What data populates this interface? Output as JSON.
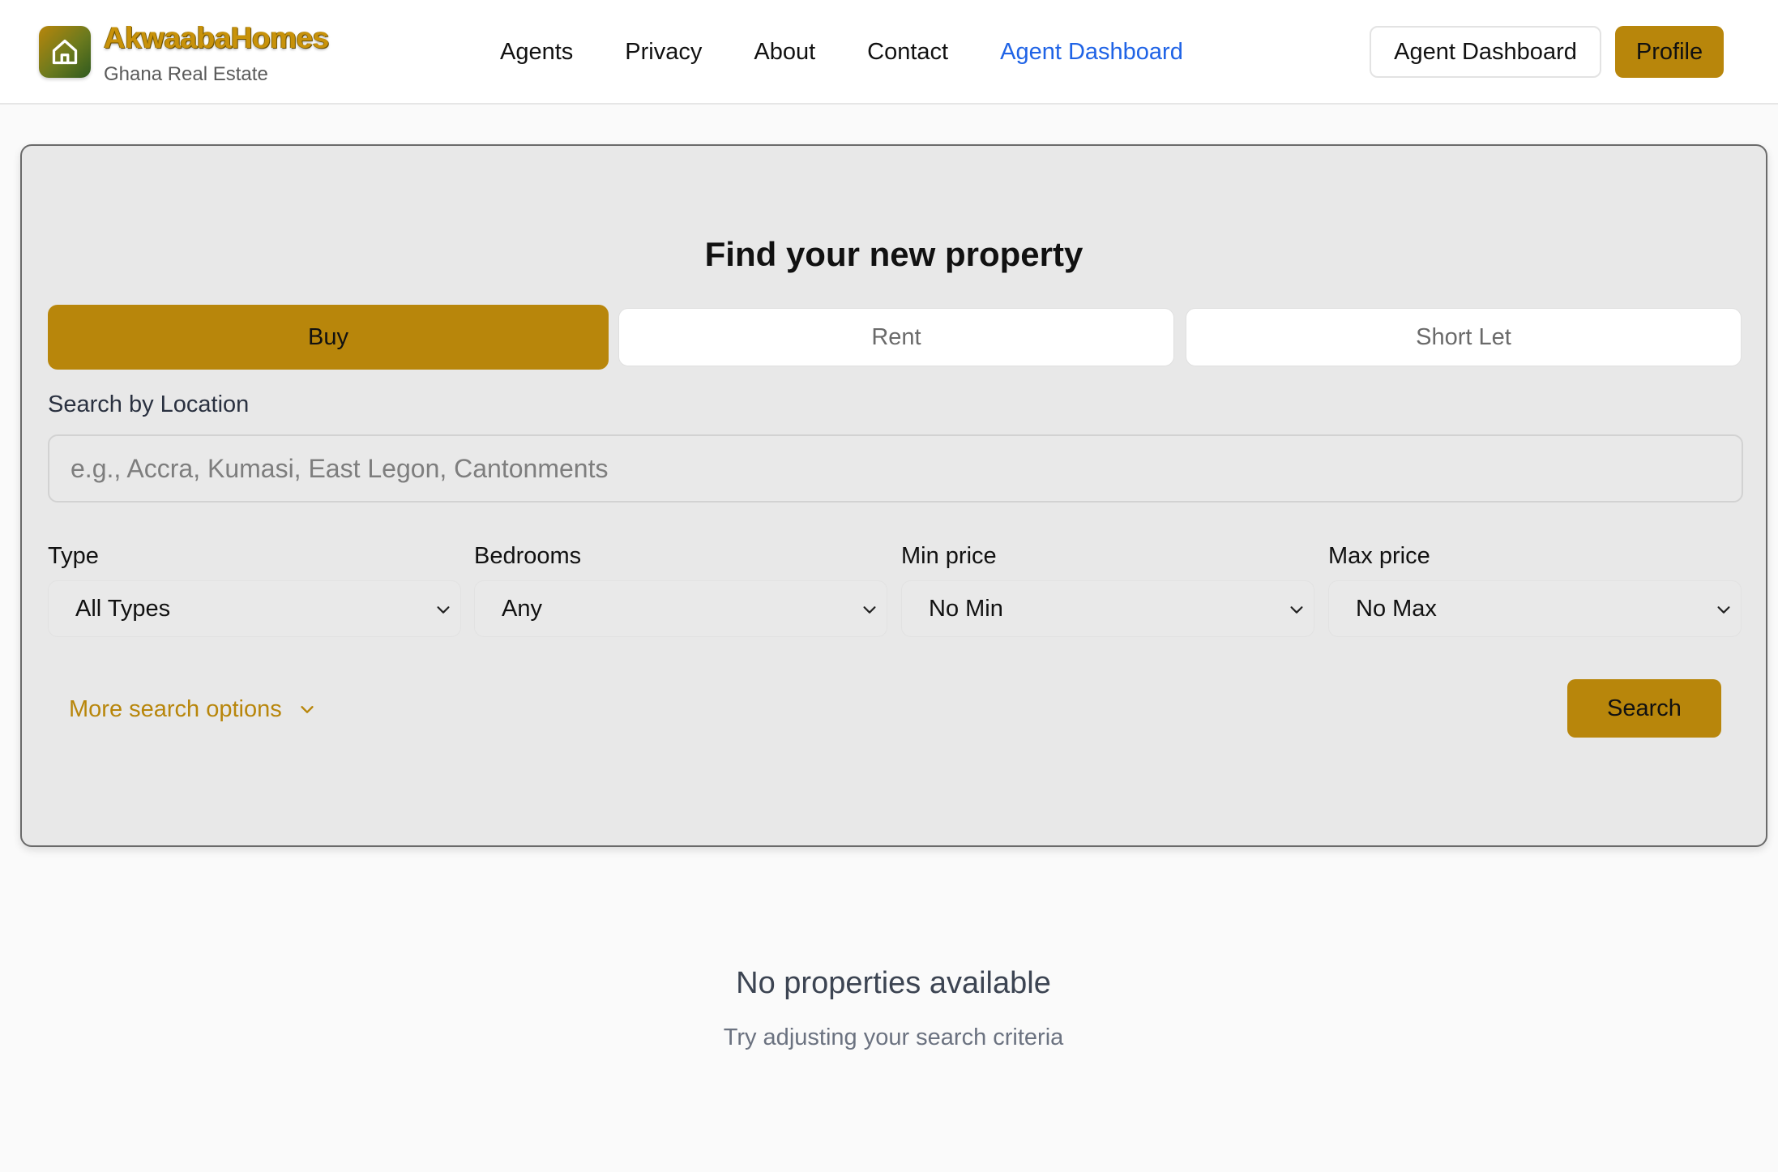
{
  "brand": {
    "name": "AkwaabaHomes",
    "tagline": "Ghana Real Estate",
    "logo_icon": "home-icon"
  },
  "nav": {
    "links": [
      "Agents",
      "Privacy",
      "About",
      "Contact",
      "Agent Dashboard"
    ],
    "active": "Agent Dashboard",
    "active_color": "#1f63e6"
  },
  "header_actions": {
    "agent_dashboard_label": "Agent Dashboard",
    "profile_label": "Profile"
  },
  "search": {
    "title": "Find your new property",
    "tabs": [
      {
        "label": "Buy",
        "selected": true
      },
      {
        "label": "Rent",
        "selected": false
      },
      {
        "label": "Short Let",
        "selected": false
      }
    ],
    "location_label": "Search by Location",
    "location_placeholder": "e.g., Accra, Kumasi, East Legon, Cantonments",
    "location_value": "",
    "filters": [
      {
        "label": "Type",
        "value": "All Types"
      },
      {
        "label": "Bedrooms",
        "value": "Any"
      },
      {
        "label": "Min price",
        "value": "No Min"
      },
      {
        "label": "Max price",
        "value": "No Max"
      }
    ],
    "more_options_label": "More search options",
    "search_button_label": "Search"
  },
  "empty_state": {
    "title": "No properties available",
    "subtitle": "Try adjusting your search criteria"
  },
  "colors": {
    "accent": "#b8860b",
    "card_bg": "#e8e8e8",
    "page_bg": "#fafafa"
  }
}
